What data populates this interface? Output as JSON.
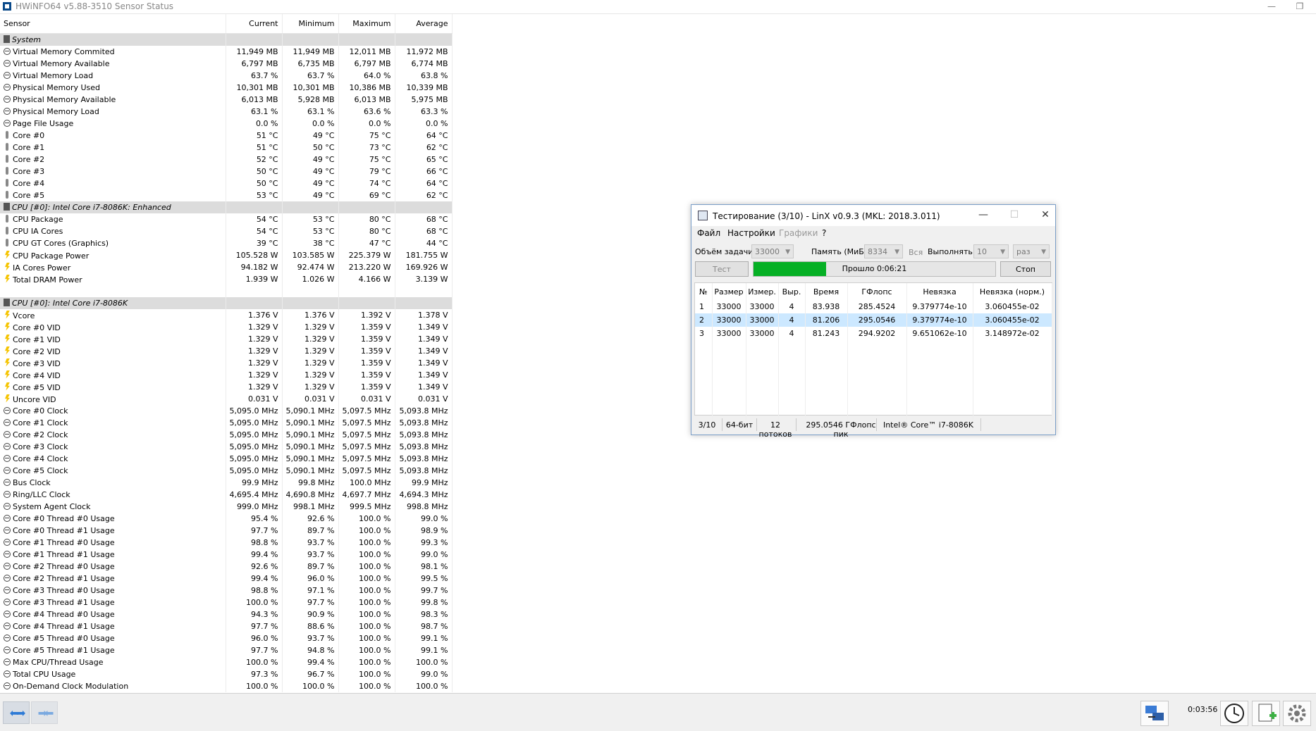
{
  "hwinfo": {
    "title": "HWiNFO64 v5.88-3510 Sensor Status",
    "columns": [
      "Sensor",
      "Current",
      "Minimum",
      "Maximum",
      "Average"
    ],
    "rows": [
      {
        "type": "group",
        "label": "System"
      },
      {
        "icon": "gauge",
        "label": "Virtual Memory Commited",
        "cur": "11,949 MB",
        "min": "11,949 MB",
        "max": "12,011 MB",
        "avg": "11,972 MB"
      },
      {
        "icon": "gauge",
        "label": "Virtual Memory Available",
        "cur": "6,797 MB",
        "min": "6,735 MB",
        "max": "6,797 MB",
        "avg": "6,774 MB"
      },
      {
        "icon": "gauge",
        "label": "Virtual Memory Load",
        "cur": "63.7 %",
        "min": "63.7 %",
        "max": "64.0 %",
        "avg": "63.8 %"
      },
      {
        "icon": "gauge",
        "label": "Physical Memory Used",
        "cur": "10,301 MB",
        "min": "10,301 MB",
        "max": "10,386 MB",
        "avg": "10,339 MB"
      },
      {
        "icon": "gauge",
        "label": "Physical Memory Available",
        "cur": "6,013 MB",
        "min": "5,928 MB",
        "max": "6,013 MB",
        "avg": "5,975 MB"
      },
      {
        "icon": "gauge",
        "label": "Physical Memory Load",
        "cur": "63.1 %",
        "min": "63.1 %",
        "max": "63.6 %",
        "avg": "63.3 %"
      },
      {
        "icon": "gauge",
        "label": "Page File Usage",
        "cur": "0.0 %",
        "min": "0.0 %",
        "max": "0.0 %",
        "avg": "0.0 %"
      },
      {
        "icon": "temp",
        "label": "Core #0",
        "cur": "51 °C",
        "min": "49 °C",
        "max": "75 °C",
        "avg": "64 °C"
      },
      {
        "icon": "temp",
        "label": "Core #1",
        "cur": "51 °C",
        "min": "50 °C",
        "max": "73 °C",
        "avg": "62 °C"
      },
      {
        "icon": "temp",
        "label": "Core #2",
        "cur": "52 °C",
        "min": "49 °C",
        "max": "75 °C",
        "avg": "65 °C"
      },
      {
        "icon": "temp",
        "label": "Core #3",
        "cur": "50 °C",
        "min": "49 °C",
        "max": "79 °C",
        "avg": "66 °C"
      },
      {
        "icon": "temp",
        "label": "Core #4",
        "cur": "50 °C",
        "min": "49 °C",
        "max": "74 °C",
        "avg": "64 °C"
      },
      {
        "icon": "temp",
        "label": "Core #5",
        "cur": "53 °C",
        "min": "49 °C",
        "max": "69 °C",
        "avg": "62 °C"
      },
      {
        "type": "group",
        "label": "CPU [#0]: Intel Core i7-8086K: Enhanced"
      },
      {
        "icon": "temp",
        "label": "CPU Package",
        "cur": "54 °C",
        "min": "53 °C",
        "max": "80 °C",
        "avg": "68 °C"
      },
      {
        "icon": "temp",
        "label": "CPU IA Cores",
        "cur": "54 °C",
        "min": "53 °C",
        "max": "80 °C",
        "avg": "68 °C"
      },
      {
        "icon": "temp",
        "label": "CPU GT Cores (Graphics)",
        "cur": "39 °C",
        "min": "38 °C",
        "max": "47 °C",
        "avg": "44 °C"
      },
      {
        "icon": "power",
        "label": "CPU Package Power",
        "cur": "105.528 W",
        "min": "103.585 W",
        "max": "225.379 W",
        "avg": "181.755 W"
      },
      {
        "icon": "power",
        "label": "IA Cores Power",
        "cur": "94.182 W",
        "min": "92.474 W",
        "max": "213.220 W",
        "avg": "169.926 W"
      },
      {
        "icon": "power",
        "label": "Total DRAM Power",
        "cur": "1.939 W",
        "min": "1.026 W",
        "max": "4.166 W",
        "avg": "3.139 W"
      },
      {
        "type": "blank"
      },
      {
        "type": "group",
        "label": "CPU [#0]: Intel Core i7-8086K"
      },
      {
        "icon": "power",
        "label": "Vcore",
        "cur": "1.376 V",
        "min": "1.376 V",
        "max": "1.392 V",
        "avg": "1.378 V"
      },
      {
        "icon": "power",
        "label": "Core #0 VID",
        "cur": "1.329 V",
        "min": "1.329 V",
        "max": "1.359 V",
        "avg": "1.349 V"
      },
      {
        "icon": "power",
        "label": "Core #1 VID",
        "cur": "1.329 V",
        "min": "1.329 V",
        "max": "1.359 V",
        "avg": "1.349 V"
      },
      {
        "icon": "power",
        "label": "Core #2 VID",
        "cur": "1.329 V",
        "min": "1.329 V",
        "max": "1.359 V",
        "avg": "1.349 V"
      },
      {
        "icon": "power",
        "label": "Core #3 VID",
        "cur": "1.329 V",
        "min": "1.329 V",
        "max": "1.359 V",
        "avg": "1.349 V"
      },
      {
        "icon": "power",
        "label": "Core #4 VID",
        "cur": "1.329 V",
        "min": "1.329 V",
        "max": "1.359 V",
        "avg": "1.349 V"
      },
      {
        "icon": "power",
        "label": "Core #5 VID",
        "cur": "1.329 V",
        "min": "1.329 V",
        "max": "1.359 V",
        "avg": "1.349 V"
      },
      {
        "icon": "power",
        "label": "Uncore VID",
        "cur": "0.031 V",
        "min": "0.031 V",
        "max": "0.031 V",
        "avg": "0.031 V"
      },
      {
        "icon": "gauge",
        "label": "Core #0 Clock",
        "cur": "5,095.0 MHz",
        "min": "5,090.1 MHz",
        "max": "5,097.5 MHz",
        "avg": "5,093.8 MHz"
      },
      {
        "icon": "gauge",
        "label": "Core #1 Clock",
        "cur": "5,095.0 MHz",
        "min": "5,090.1 MHz",
        "max": "5,097.5 MHz",
        "avg": "5,093.8 MHz"
      },
      {
        "icon": "gauge",
        "label": "Core #2 Clock",
        "cur": "5,095.0 MHz",
        "min": "5,090.1 MHz",
        "max": "5,097.5 MHz",
        "avg": "5,093.8 MHz"
      },
      {
        "icon": "gauge",
        "label": "Core #3 Clock",
        "cur": "5,095.0 MHz",
        "min": "5,090.1 MHz",
        "max": "5,097.5 MHz",
        "avg": "5,093.8 MHz"
      },
      {
        "icon": "gauge",
        "label": "Core #4 Clock",
        "cur": "5,095.0 MHz",
        "min": "5,090.1 MHz",
        "max": "5,097.5 MHz",
        "avg": "5,093.8 MHz"
      },
      {
        "icon": "gauge",
        "label": "Core #5 Clock",
        "cur": "5,095.0 MHz",
        "min": "5,090.1 MHz",
        "max": "5,097.5 MHz",
        "avg": "5,093.8 MHz"
      },
      {
        "icon": "gauge",
        "label": "Bus Clock",
        "cur": "99.9 MHz",
        "min": "99.8 MHz",
        "max": "100.0 MHz",
        "avg": "99.9 MHz"
      },
      {
        "icon": "gauge",
        "label": "Ring/LLC Clock",
        "cur": "4,695.4 MHz",
        "min": "4,690.8 MHz",
        "max": "4,697.7 MHz",
        "avg": "4,694.3 MHz"
      },
      {
        "icon": "gauge",
        "label": "System Agent Clock",
        "cur": "999.0 MHz",
        "min": "998.1 MHz",
        "max": "999.5 MHz",
        "avg": "998.8 MHz"
      },
      {
        "icon": "gauge",
        "label": "Core #0 Thread #0 Usage",
        "cur": "95.4 %",
        "min": "92.6 %",
        "max": "100.0 %",
        "avg": "99.0 %"
      },
      {
        "icon": "gauge",
        "label": "Core #0 Thread #1 Usage",
        "cur": "97.7 %",
        "min": "89.7 %",
        "max": "100.0 %",
        "avg": "98.9 %"
      },
      {
        "icon": "gauge",
        "label": "Core #1 Thread #0 Usage",
        "cur": "98.8 %",
        "min": "93.7 %",
        "max": "100.0 %",
        "avg": "99.3 %"
      },
      {
        "icon": "gauge",
        "label": "Core #1 Thread #1 Usage",
        "cur": "99.4 %",
        "min": "93.7 %",
        "max": "100.0 %",
        "avg": "99.0 %"
      },
      {
        "icon": "gauge",
        "label": "Core #2 Thread #0 Usage",
        "cur": "92.6 %",
        "min": "89.7 %",
        "max": "100.0 %",
        "avg": "98.1 %"
      },
      {
        "icon": "gauge",
        "label": "Core #2 Thread #1 Usage",
        "cur": "99.4 %",
        "min": "96.0 %",
        "max": "100.0 %",
        "avg": "99.5 %"
      },
      {
        "icon": "gauge",
        "label": "Core #3 Thread #0 Usage",
        "cur": "98.8 %",
        "min": "97.1 %",
        "max": "100.0 %",
        "avg": "99.7 %"
      },
      {
        "icon": "gauge",
        "label": "Core #3 Thread #1 Usage",
        "cur": "100.0 %",
        "min": "97.7 %",
        "max": "100.0 %",
        "avg": "99.8 %"
      },
      {
        "icon": "gauge",
        "label": "Core #4 Thread #0 Usage",
        "cur": "94.3 %",
        "min": "90.9 %",
        "max": "100.0 %",
        "avg": "98.3 %"
      },
      {
        "icon": "gauge",
        "label": "Core #4 Thread #1 Usage",
        "cur": "97.7 %",
        "min": "88.6 %",
        "max": "100.0 %",
        "avg": "98.7 %"
      },
      {
        "icon": "gauge",
        "label": "Core #5 Thread #0 Usage",
        "cur": "96.0 %",
        "min": "93.7 %",
        "max": "100.0 %",
        "avg": "99.1 %"
      },
      {
        "icon": "gauge",
        "label": "Core #5 Thread #1 Usage",
        "cur": "97.7 %",
        "min": "94.8 %",
        "max": "100.0 %",
        "avg": "99.1 %"
      },
      {
        "icon": "gauge",
        "label": "Max CPU/Thread Usage",
        "cur": "100.0 %",
        "min": "99.4 %",
        "max": "100.0 %",
        "avg": "100.0 %"
      },
      {
        "icon": "gauge",
        "label": "Total CPU Usage",
        "cur": "97.3 %",
        "min": "96.7 %",
        "max": "100.0 %",
        "avg": "99.0 %"
      },
      {
        "icon": "gauge",
        "label": "On-Demand Clock Modulation",
        "cur": "100.0 %",
        "min": "100.0 %",
        "max": "100.0 %",
        "avg": "100.0 %"
      }
    ],
    "bottom": {
      "timer": "0:03:56",
      "icons": [
        "nav-back-forward-icon",
        "nav-forward-back-icon",
        "network-icon",
        "clock-icon",
        "add-report-icon",
        "settings-icon"
      ]
    }
  },
  "linx": {
    "title": "Тестирование (3/10) - LinX v0.9.3 (MKL: 2018.3.011)",
    "menu": [
      "Файл",
      "Настройки",
      "Графики",
      "?"
    ],
    "task_label": "Объём задачи:",
    "task_value": "33000",
    "memory_label": "Память (МиБ):",
    "memory_value": "8334",
    "all_label": "Вся",
    "run_label": "Выполнять:",
    "run_value": "10",
    "run_unit": "раз",
    "test_button": "Тест",
    "progress_text": "Прошло 0:06:21",
    "progress_fraction": 0.3,
    "stop_button": "Стоп",
    "columns": [
      "№",
      "Размер",
      "Измер.",
      "Выр.",
      "Время",
      "ГФлопс",
      "Невязка",
      "Невязка (норм.)"
    ],
    "results": [
      [
        "1",
        "33000",
        "33000",
        "4",
        "83.938",
        "285.4524",
        "9.379774e-10",
        "3.060455e-02"
      ],
      [
        "2",
        "33000",
        "33000",
        "4",
        "81.206",
        "295.0546",
        "9.379774e-10",
        "3.060455e-02"
      ],
      [
        "3",
        "33000",
        "33000",
        "4",
        "81.243",
        "294.9202",
        "9.651062e-10",
        "3.148972e-02"
      ]
    ],
    "status": [
      "3/10",
      "64-бит",
      "12 потоков",
      "295.0546 ГФлопс пик",
      "Intel® Core™ i7-8086K"
    ],
    "accent_progress": "#06b025"
  }
}
